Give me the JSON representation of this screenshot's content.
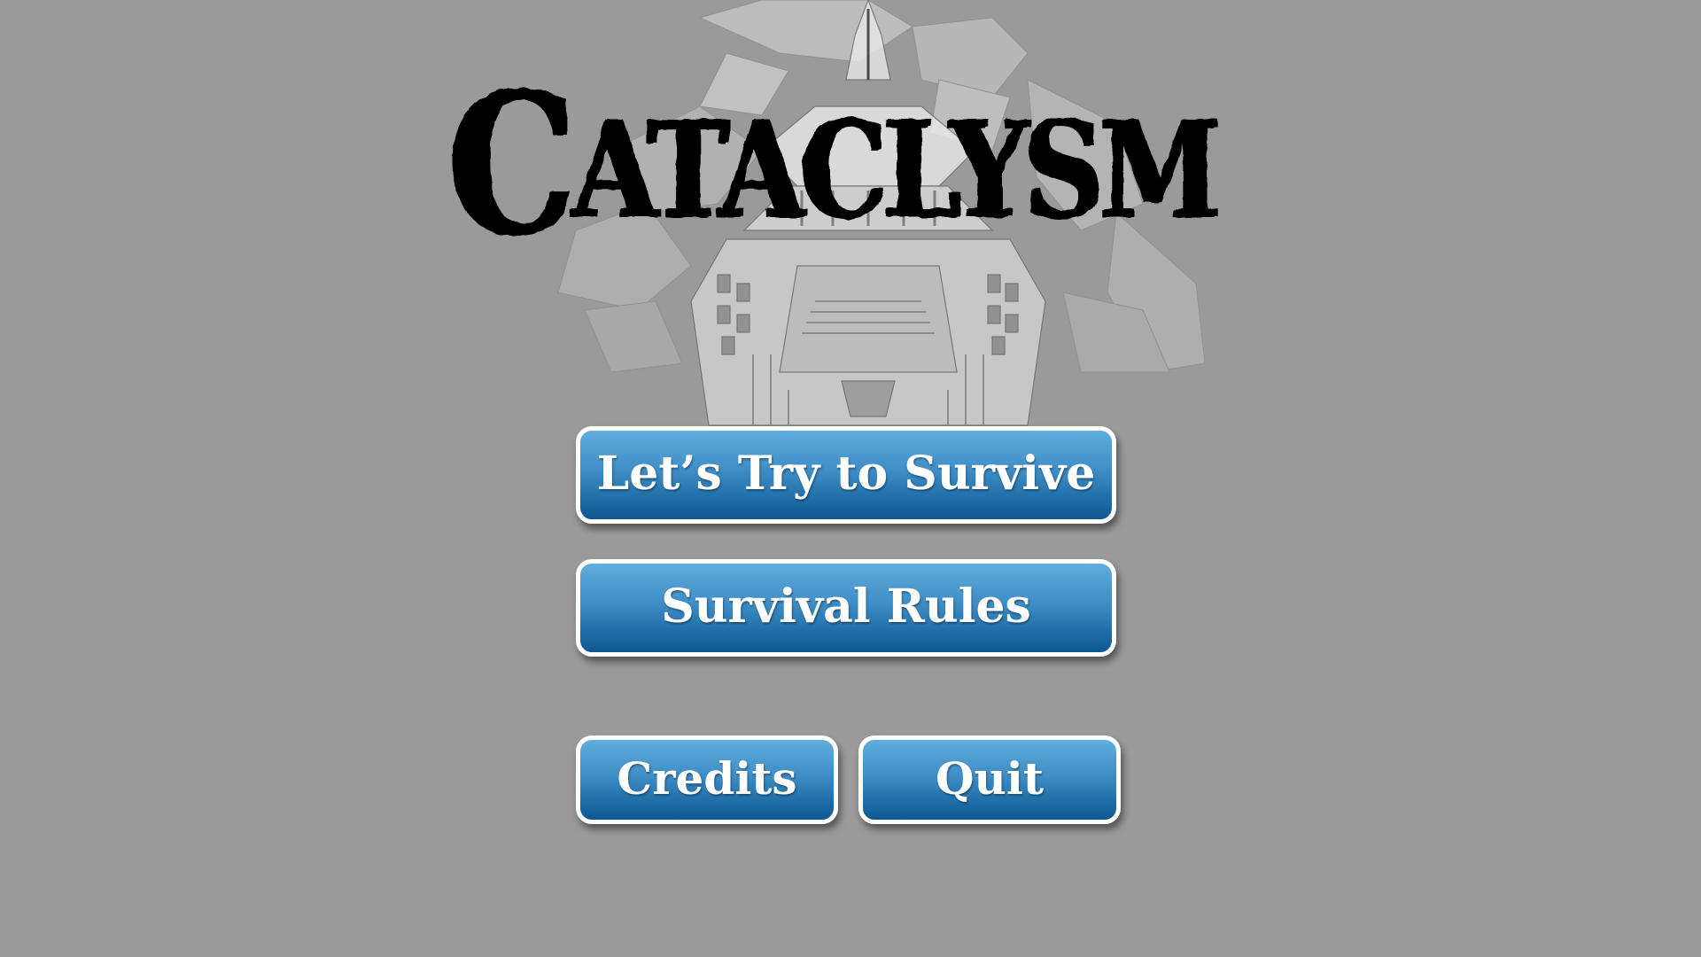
{
  "game": {
    "title": "Cataclysm",
    "title_first_letter": "C",
    "title_rest": "ataclysm"
  },
  "background": {
    "art": "stone-fortress-on-rock-icon",
    "color": "#9a9a9a"
  },
  "menu": {
    "start_label": "Let’s Try to Survive",
    "rules_label": "Survival Rules",
    "credits_label": "Credits",
    "quit_label": "Quit"
  },
  "colors": {
    "button_top": "#60addf",
    "button_bottom": "#0f578f",
    "button_border": "#ffffff",
    "button_text": "#ffffff",
    "logo": "#000000"
  }
}
